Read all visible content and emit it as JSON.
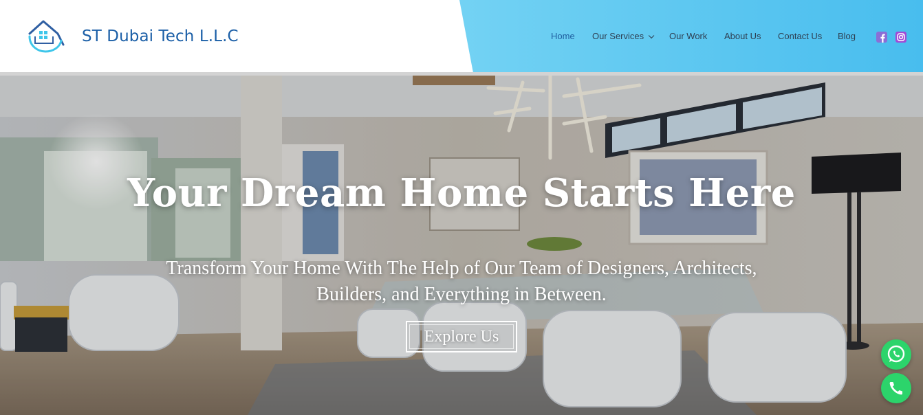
{
  "header": {
    "brand": "ST Dubai Tech L.L.C",
    "logo_icon": "house-logo-icon",
    "nav": [
      {
        "label": "Home",
        "active": true
      },
      {
        "label": "Our Services",
        "has_dropdown": true
      },
      {
        "label": "Our Work"
      },
      {
        "label": "About Us"
      },
      {
        "label": "Contact Us"
      },
      {
        "label": "Blog"
      }
    ],
    "social": [
      "facebook-icon",
      "instagram-icon"
    ]
  },
  "hero": {
    "title": "Your Dream Home Starts Here",
    "subtitle_line1": "Transform Your Home With The Help of Our Team of Designers, Architects,",
    "subtitle_line2": "Builders, and Everything in Between.",
    "cta": "Explore Us",
    "background_icon": "dining-room-photo"
  },
  "floating": {
    "whatsapp_icon": "whatsapp-icon",
    "phone_icon": "phone-icon",
    "color": "#2cd46b"
  },
  "colors": {
    "brand_text": "#1b5fa7",
    "header_blue": "#77d4f4",
    "nav_text": "#2e3f52"
  }
}
